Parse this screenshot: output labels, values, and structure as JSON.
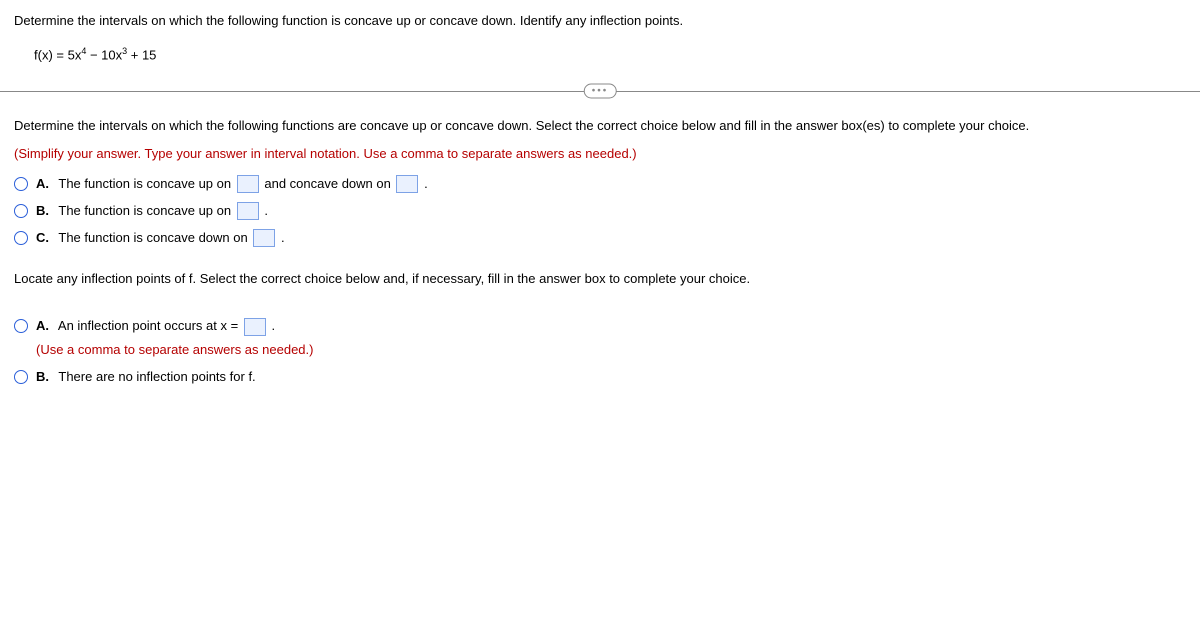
{
  "problem": {
    "statement": "Determine the intervals on which the following function is concave up or concave down. Identify any inflection points.",
    "equation_prefix": "f(x) = 5x",
    "equation_sup1": "4",
    "equation_mid": " − 10x",
    "equation_sup2": "3",
    "equation_suffix": " + 15"
  },
  "ellipsis": "•••",
  "part1": {
    "instructions": "Determine the intervals on which the following functions are concave up or concave down. Select the correct choice below and fill in the answer box(es) to complete your choice.",
    "hint": "(Simplify your answer. Type your answer in interval notation. Use a comma to separate answers as needed.)",
    "choices": {
      "a": {
        "label": "A.",
        "text1": "The function is concave up on ",
        "text2": " and concave down on ",
        "text3": " ."
      },
      "b": {
        "label": "B.",
        "text1": "The function is concave up on ",
        "text2": " ."
      },
      "c": {
        "label": "C.",
        "text1": "The function is concave down on ",
        "text2": " ."
      }
    }
  },
  "part2": {
    "instructions": "Locate any inflection points of f. Select the correct choice below and, if necessary, fill in the answer box to complete your choice.",
    "choices": {
      "a": {
        "label": "A.",
        "text1": "An inflection point occurs at x = ",
        "text2": " .",
        "sub": "(Use a comma to separate answers as needed.)"
      },
      "b": {
        "label": "B.",
        "text1": "There are no inflection points for f."
      }
    }
  }
}
